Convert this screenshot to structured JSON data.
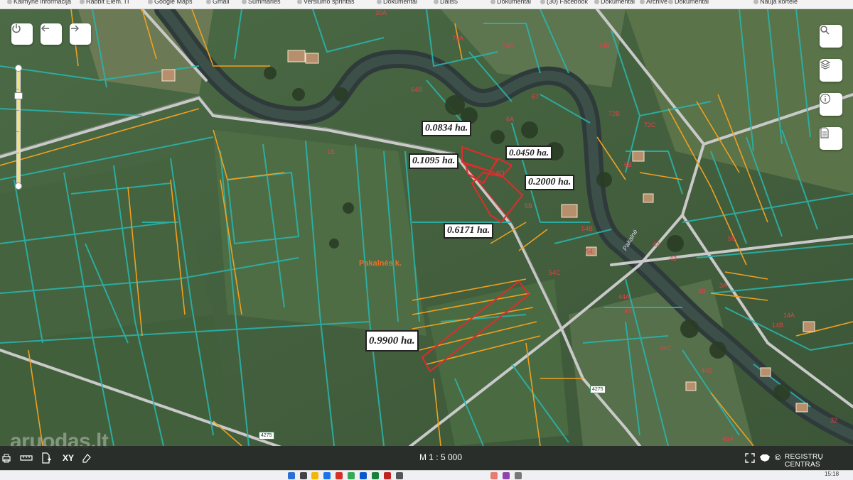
{
  "bookmarks": [
    {
      "label": "Kaimynė informacija"
    },
    {
      "label": "Rabbit Elem. IT"
    },
    {
      "label": "Google Maps"
    },
    {
      "label": "Gmail"
    },
    {
      "label": "Summaries"
    },
    {
      "label": "Verslumo sprintas"
    },
    {
      "label": "Dokumentai"
    },
    {
      "label": "Dalis5"
    },
    {
      "label": "Dokumentai"
    },
    {
      "label": "(30) Facebook"
    },
    {
      "label": "Dokumentai"
    },
    {
      "label": "Archive"
    },
    {
      "label": "Dokumentai"
    },
    {
      "label": "Nauja kortelė"
    }
  ],
  "map": {
    "area_labels": {
      "a1": "0.0834 ha.",
      "a2": "0.1095 ha.",
      "a3": "0.0450 ha.",
      "a4": "0.2000 ha.",
      "a5": "0.6171 ha.",
      "a6": "0.9900 ha."
    },
    "village_label": "Pakalnės k.",
    "street_label": "Pakalnė",
    "road_labels": {
      "r1": "4275",
      "r2": "4275"
    },
    "parcel_numbers": [
      "30A",
      "76A",
      "74B",
      "74B",
      "64B",
      "64",
      "67",
      "6A",
      "6B",
      "72C",
      "72B",
      "6B",
      "6D",
      "5B",
      "54B",
      "54",
      "54C",
      "44A",
      "44",
      "44C",
      "44D",
      "42",
      "42",
      "3B",
      "3A",
      "14A",
      "14B",
      "32",
      "68",
      "56",
      "1A",
      "1B",
      "46A"
    ]
  },
  "controls": {
    "power_icon": "power-icon",
    "back_icon": "arrow-left-icon",
    "forward_icon": "arrow-right-icon",
    "search_icon": "search-icon",
    "layers_icon": "layers-icon",
    "info_icon": "info-icon",
    "document_icon": "document-icon",
    "zoom_level": 0.22
  },
  "bottom_bar": {
    "xy_label": "XY",
    "scale_label": "M 1 : 5 000",
    "credit_label": "REGISTRŲ CENTRAS"
  },
  "watermark": "aruodas.lt",
  "taskbar": {
    "clock": "15:18"
  },
  "colors": {
    "cadastral_boundary": "#2ab3aa",
    "parcel_boundary_orange": "#f0a020",
    "selected_parcel": "#e12b2b",
    "river": "#2f3b3a",
    "road": "#c9c9c9"
  }
}
